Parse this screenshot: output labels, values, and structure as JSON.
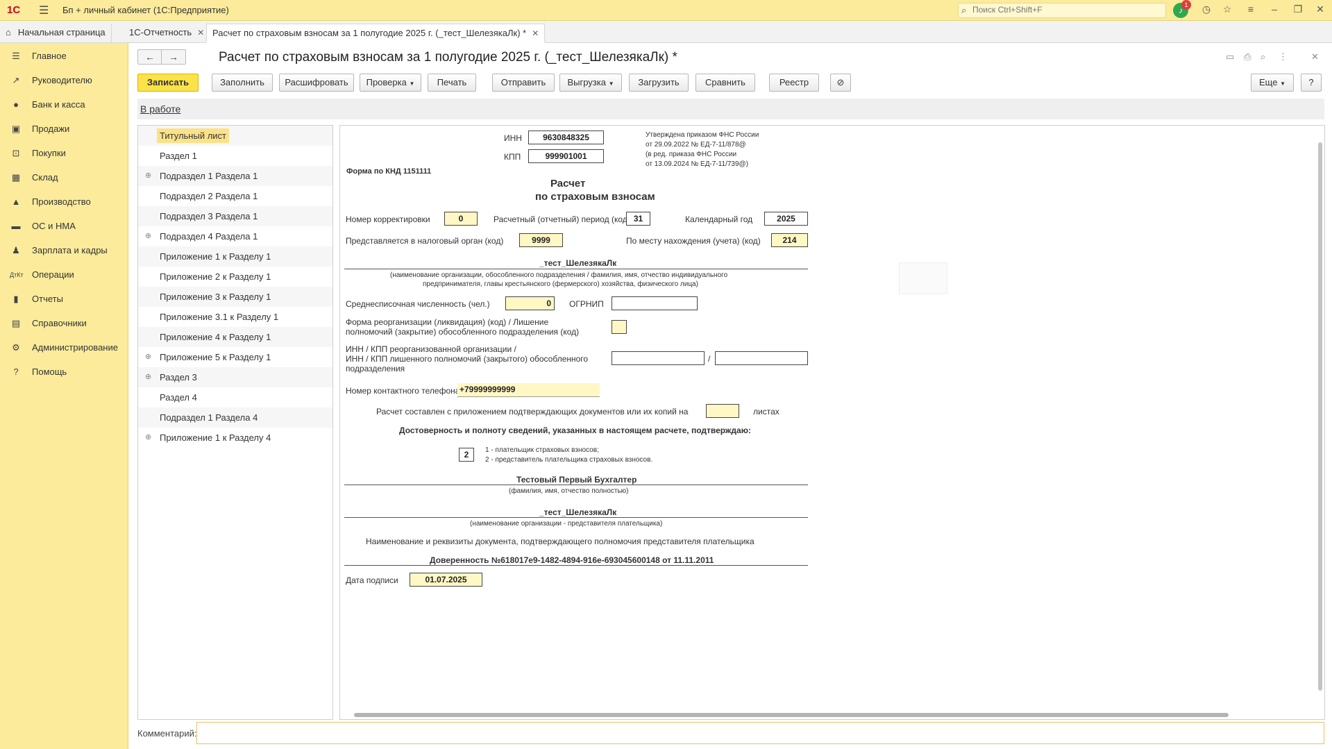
{
  "app": {
    "logo": "1С",
    "title": "Бп + личный кабинет  (1С:Предприятие)",
    "search_placeholder": "Поиск Ctrl+Shift+F",
    "notifications_count": "1"
  },
  "tabs": [
    {
      "label": "Начальная страница"
    },
    {
      "label": "1С-Отчетность"
    },
    {
      "label": "Расчет по страховым взносам за 1 полугодие 2025 г. (_тест_ШелезякаЛк) *"
    }
  ],
  "sidebar": {
    "items": [
      {
        "label": "Главное",
        "icon": "menu-icon"
      },
      {
        "label": "Руководителю",
        "icon": "trend-icon"
      },
      {
        "label": "Банк и касса",
        "icon": "coin-icon"
      },
      {
        "label": "Продажи",
        "icon": "bag-icon"
      },
      {
        "label": "Покупки",
        "icon": "cart-icon"
      },
      {
        "label": "Склад",
        "icon": "grid-icon"
      },
      {
        "label": "Производство",
        "icon": "factory-icon"
      },
      {
        "label": "ОС и НМА",
        "icon": "truck-icon"
      },
      {
        "label": "Зарплата и кадры",
        "icon": "person-icon"
      },
      {
        "label": "Операции",
        "icon": "dt-kt-icon"
      },
      {
        "label": "Отчеты",
        "icon": "chart-icon"
      },
      {
        "label": "Справочники",
        "icon": "book-icon"
      },
      {
        "label": "Администрирование",
        "icon": "gear-icon"
      },
      {
        "label": "Помощь",
        "icon": "question-icon"
      }
    ]
  },
  "document": {
    "title": "Расчет по страховым взносам за 1 полугодие 2025 г. (_тест_ШелезякаЛк) *",
    "status": "В работе"
  },
  "toolbar": {
    "save": "Записать",
    "fill": "Заполнить",
    "decode": "Расшифровать",
    "check": "Проверка",
    "print": "Печать",
    "send": "Отправить",
    "export": "Выгрузка",
    "load": "Загрузить",
    "compare": "Сравнить",
    "registry": "Реестр",
    "more": "Еще",
    "help": "?"
  },
  "tree": [
    {
      "label": "Титульный лист",
      "expandable": false,
      "selected": true
    },
    {
      "label": "Раздел 1",
      "expandable": false
    },
    {
      "label": "Подраздел 1 Раздела 1",
      "expandable": true
    },
    {
      "label": "Подраздел 2 Раздела 1",
      "expandable": false
    },
    {
      "label": "Подраздел 3 Раздела 1",
      "expandable": false
    },
    {
      "label": "Подраздел 4 Раздела 1",
      "expandable": true
    },
    {
      "label": "Приложение 1 к Разделу 1",
      "expandable": false
    },
    {
      "label": "Приложение 2 к Разделу 1",
      "expandable": false
    },
    {
      "label": "Приложение 3 к Разделу 1",
      "expandable": false
    },
    {
      "label": "Приложение 3.1 к Разделу 1",
      "expandable": false
    },
    {
      "label": "Приложение 4 к Разделу 1",
      "expandable": false
    },
    {
      "label": "Приложение 5 к Разделу 1",
      "expandable": true
    },
    {
      "label": "Раздел 3",
      "expandable": true
    },
    {
      "label": "Раздел 4",
      "expandable": false
    },
    {
      "label": "Подраздел 1 Раздела 4",
      "expandable": false
    },
    {
      "label": "Приложение 1 к Разделу 4",
      "expandable": true
    }
  ],
  "form": {
    "inn_label": "ИНН",
    "inn": "9630848325",
    "kpp_label": "КПП",
    "kpp": "999901001",
    "approved": [
      "Утверждена приказом ФНС России",
      "от 29.09.2022 № ЕД-7-11/878@",
      "(в ред. приказа ФНС России",
      "от 13.09.2024 № ЕД-7-11/739@)"
    ],
    "knd": "Форма по КНД 1151111",
    "heading1": "Расчет",
    "heading2": "по страховым взносам",
    "correction_label": "Номер корректировки",
    "correction": "0",
    "period_label": "Расчетный (отчетный) период (код)",
    "period": "31",
    "year_label": "Календарный год",
    "year": "2025",
    "tax_office_label": "Представляется в налоговый орган (код)",
    "tax_office": "9999",
    "location_label": "По месту нахождения (учета) (код)",
    "location": "214",
    "org_name": "_тест_ШелезякаЛк",
    "org_caption1": "(наименование организации, обособленного подразделения / фамилия, имя, отчество индивидуального",
    "org_caption2": "предпринимателя, главы крестьянского (фермерского) хозяйства, физического лица)",
    "headcount_label": "Среднесписочная численность (чел.)",
    "headcount": "0",
    "ogrnip_label": "ОГРНИП",
    "ogrnip": "",
    "reorg_label1": "Форма реорганизации (ликвидация) (код) / Лишение",
    "reorg_label2": "полномочий (закрытие) обособленного подразделения (код)",
    "reorg_inn_label1": "ИНН / КПП реорганизованной организации /",
    "reorg_inn_label2": "ИНН / КПП лишенного полномочий (закрытого) обособленного",
    "reorg_inn_label3": "подразделения",
    "slash": "/",
    "phone_label": "Номер контактного телефона",
    "phone": "+79999999999",
    "attached_label": "Расчет составлен с приложением подтверждающих документов или их копий на",
    "sheets_label": "листах",
    "confirm_heading": "Достоверность и полноту сведений, указанных в настоящем расчете, подтверждаю:",
    "confirm_code": "2",
    "confirm_opt1": "1 - плательщик страховых взносов;",
    "confirm_opt2": "2 - представитель плательщика страховых взносов.",
    "signer": "Тестовый Первый Бухгалтер",
    "signer_caption": "(фамилия, имя, отчество полностью)",
    "rep_org": "_тест_ШелезякаЛк",
    "rep_org_caption": "(наименование организации - представителя плательщика)",
    "doc_caption": "Наименование и реквизиты документа, подтверждающего полномочия представителя плательщика",
    "doc_value": "Доверенность №618017e9-1482-4894-916e-693045600148 от 11.11.2011",
    "sign_date_label": "Дата подписи",
    "sign_date": "01.07.2025"
  },
  "comment": {
    "label": "Комментарий:",
    "value": ""
  }
}
